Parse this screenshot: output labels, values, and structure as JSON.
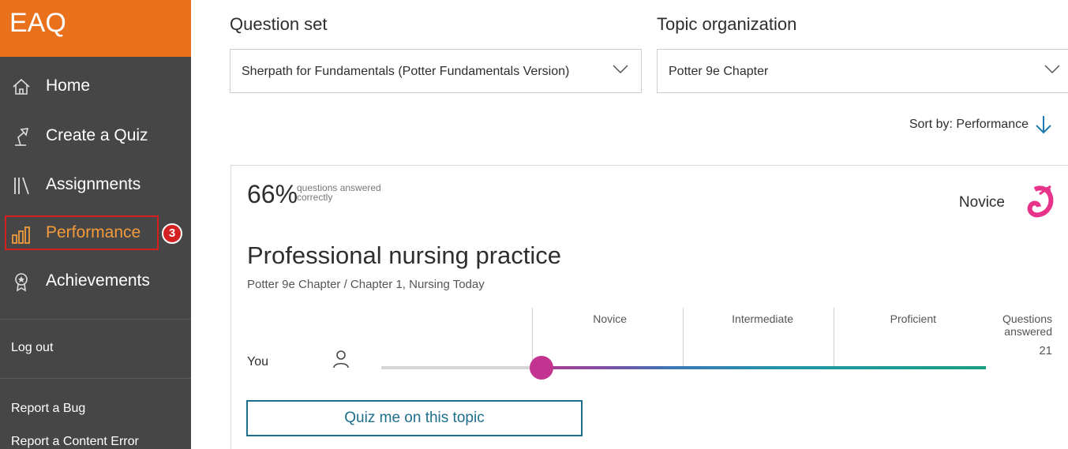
{
  "brand": {
    "name": "EAQ"
  },
  "nav": {
    "home": "Home",
    "create_quiz": "Create a Quiz",
    "assignments": "Assignments",
    "performance": "Performance",
    "achievements": "Achievements",
    "step_badge": "3"
  },
  "side_links": {
    "logout": "Log out",
    "report_bug": "Report a Bug",
    "report_content_error": "Report a Content Error"
  },
  "filters": {
    "question_set_label": "Question set",
    "question_set_value": "Sherpath for Fundamentals (Potter Fundamentals Version)",
    "topic_org_label": "Topic organization",
    "topic_org_value": "Potter 9e Chapter"
  },
  "sort": {
    "label": "Sort by: Performance"
  },
  "card": {
    "percent": "66%",
    "percent_note": "questions answered correctly",
    "level": "Novice",
    "title": "Professional nursing practice",
    "path": "Potter 9e Chapter / Chapter 1, Nursing Today",
    "stages": [
      "Novice",
      "Intermediate",
      "Proficient"
    ],
    "questions_answered_label": "Questions answered",
    "questions_answered": "21",
    "you_label": "You",
    "quiz_button": "Quiz me on this topic"
  },
  "colors": {
    "brand_orange": "#e9711c",
    "sidebar_bg": "#464646",
    "active_text": "#f29a3c",
    "highlight_red": "#d42020",
    "thumb": "#c2348f",
    "button_teal": "#1e6e8c"
  }
}
